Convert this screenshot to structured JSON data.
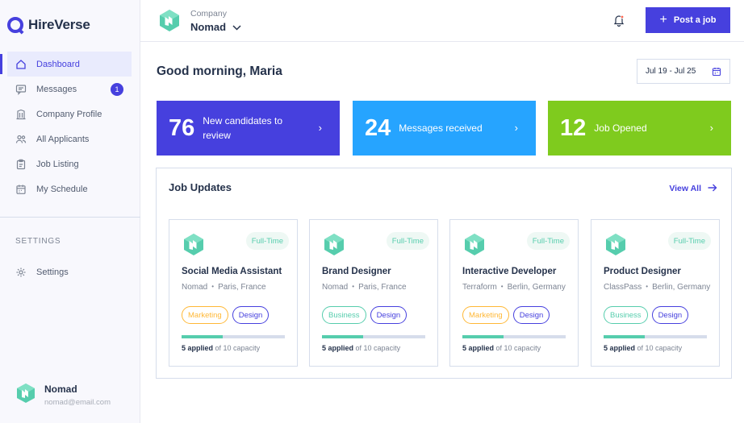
{
  "brand": {
    "name": "HireVerse"
  },
  "sidebar": {
    "items": [
      {
        "label": "Dashboard",
        "icon": "home-icon",
        "active": true
      },
      {
        "label": "Messages",
        "icon": "chat-icon",
        "badge": "1"
      },
      {
        "label": "Company Profile",
        "icon": "building-icon"
      },
      {
        "label": "All Applicants",
        "icon": "users-icon"
      },
      {
        "label": "Job Listing",
        "icon": "clipboard-icon"
      },
      {
        "label": "My Schedule",
        "icon": "calendar-icon"
      }
    ],
    "settings_title": "SETTINGS",
    "settings_item": {
      "label": "Settings",
      "icon": "gear-icon"
    }
  },
  "profile": {
    "name": "Nomad",
    "email": "nomad@email.com"
  },
  "header": {
    "company_label": "Company",
    "company_name": "Nomad",
    "post_button": "Post a job"
  },
  "main": {
    "greeting": "Good morning, Maria",
    "date_range": "Jul 19 - Jul 25",
    "stats": [
      {
        "number": "76",
        "label": "New candidates to review",
        "color": "#4640de"
      },
      {
        "number": "24",
        "label": "Messages received",
        "color": "#26a4ff"
      },
      {
        "number": "12",
        "label": "Job Opened",
        "color": "#7fcb1e"
      }
    ],
    "updates_title": "Job Updates",
    "view_all": "View All"
  },
  "jobs": [
    {
      "type": "Full-Time",
      "title": "Social Media Assistant",
      "company": "Nomad",
      "location": "Paris, France",
      "tags": [
        {
          "label": "Marketing",
          "style": "marketing"
        },
        {
          "label": "Design",
          "style": "design"
        }
      ],
      "applied": "5 applied",
      "capacity": "of 10 capacity",
      "progress": 0.4
    },
    {
      "type": "Full-Time",
      "title": "Brand Designer",
      "company": "Nomad",
      "location": "Paris, France",
      "tags": [
        {
          "label": "Business",
          "style": "business"
        },
        {
          "label": "Design",
          "style": "design"
        }
      ],
      "applied": "5 applied",
      "capacity": "of 10 capacity",
      "progress": 0.4
    },
    {
      "type": "Full-Time",
      "title": "Interactive Developer",
      "company": "Terraform",
      "location": "Berlin, Germany",
      "tags": [
        {
          "label": "Marketing",
          "style": "marketing"
        },
        {
          "label": "Design",
          "style": "design"
        }
      ],
      "applied": "5 applied",
      "capacity": "of 10 capacity",
      "progress": 0.4
    },
    {
      "type": "Full-Time",
      "title": "Product Designer",
      "company": "ClassPass",
      "location": "Berlin, Germany",
      "tags": [
        {
          "label": "Business",
          "style": "business"
        },
        {
          "label": "Design",
          "style": "design"
        }
      ],
      "applied": "5 applied",
      "capacity": "of 10 capacity",
      "progress": 0.4
    }
  ]
}
